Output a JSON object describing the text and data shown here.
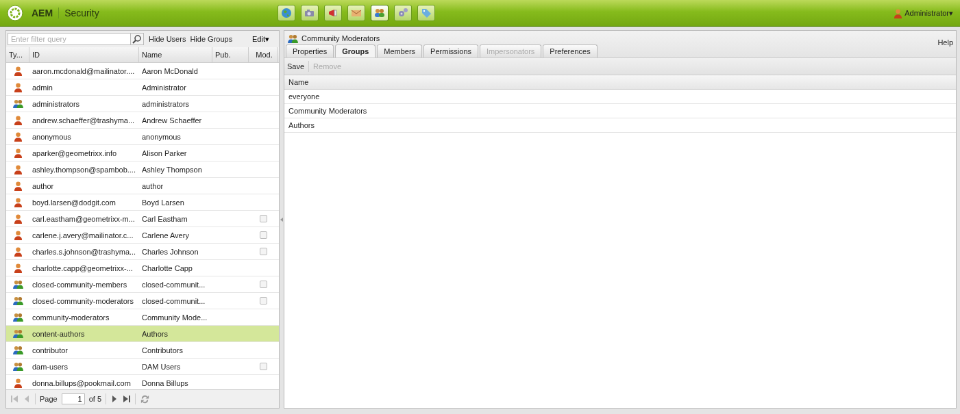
{
  "topbar": {
    "brand": "AEM",
    "section": "Security",
    "user": "Administrator",
    "caret": "▾"
  },
  "consoles": [
    {
      "kind": "globe",
      "selected": false
    },
    {
      "kind": "camera",
      "selected": false
    },
    {
      "kind": "megaphone",
      "selected": false
    },
    {
      "kind": "envelope",
      "selected": false
    },
    {
      "kind": "people",
      "selected": true
    },
    {
      "kind": "gears",
      "selected": false
    },
    {
      "kind": "tag",
      "selected": false
    }
  ],
  "left": {
    "filter": {
      "placeholder": "Enter filter query"
    },
    "links": [
      "Hide Users",
      "Hide Groups"
    ],
    "edit": "Edit",
    "caret": "▾",
    "columns": [
      "Ty...",
      "ID",
      "Name",
      "Pub.",
      "Mod."
    ],
    "rows": [
      {
        "kind": "user",
        "id": "aaron.mcdonald@mailinator....",
        "name": "Aaron McDonald",
        "selected": false
      },
      {
        "kind": "user",
        "id": "admin",
        "name": "Administrator",
        "selected": false
      },
      {
        "kind": "group",
        "id": "administrators",
        "name": "administrators",
        "selected": false
      },
      {
        "kind": "user",
        "id": "andrew.schaeffer@trashyma...",
        "name": "Andrew Schaeffer",
        "selected": false
      },
      {
        "kind": "user",
        "id": "anonymous",
        "name": "anonymous",
        "selected": false
      },
      {
        "kind": "user",
        "id": "aparker@geometrixx.info",
        "name": "Alison Parker",
        "selected": false
      },
      {
        "kind": "user",
        "id": "ashley.thompson@spambob....",
        "name": "Ashley Thompson",
        "selected": false
      },
      {
        "kind": "user",
        "id": "author",
        "name": "author",
        "selected": false
      },
      {
        "kind": "user",
        "id": "boyd.larsen@dodgit.com",
        "name": "Boyd Larsen",
        "selected": false
      },
      {
        "kind": "user",
        "id": "carl.eastham@geometrixx-m...",
        "name": "Carl Eastham",
        "selected": false,
        "moderated": false
      },
      {
        "kind": "user",
        "id": "carlene.j.avery@mailinator.c...",
        "name": "Carlene Avery",
        "selected": false,
        "moderated": false
      },
      {
        "kind": "user",
        "id": "charles.s.johnson@trashyma...",
        "name": "Charles Johnson",
        "selected": false,
        "moderated": false
      },
      {
        "kind": "user",
        "id": "charlotte.capp@geometrixx-...",
        "name": "Charlotte Capp",
        "selected": false
      },
      {
        "kind": "group",
        "id": "closed-community-members",
        "name": "closed-communit...",
        "selected": false,
        "moderated": false
      },
      {
        "kind": "group",
        "id": "closed-community-moderators",
        "name": "closed-communit...",
        "selected": false,
        "moderated": false
      },
      {
        "kind": "group",
        "id": "community-moderators",
        "name": "Community Mode...",
        "selected": false
      },
      {
        "kind": "group",
        "id": "content-authors",
        "name": "Authors",
        "selected": true
      },
      {
        "kind": "group",
        "id": "contributor",
        "name": "Contributors",
        "selected": false
      },
      {
        "kind": "group",
        "id": "dam-users",
        "name": "DAM Users",
        "selected": false,
        "moderated": false
      },
      {
        "kind": "user",
        "id": "donna.billups@pookmail.com",
        "name": "Donna Billups",
        "selected": false
      }
    ],
    "pager": {
      "label": "Page",
      "page": "1",
      "of": "of 5"
    }
  },
  "right": {
    "title": "Community Moderators",
    "help": "Help",
    "tabs": [
      {
        "label": "Properties",
        "selected": false,
        "disabled": false
      },
      {
        "label": "Groups",
        "selected": true,
        "disabled": false
      },
      {
        "label": "Members",
        "selected": false,
        "disabled": false
      },
      {
        "label": "Permissions",
        "selected": false,
        "disabled": false
      },
      {
        "label": "Impersonators",
        "selected": false,
        "disabled": true
      },
      {
        "label": "Preferences",
        "selected": false,
        "disabled": false
      }
    ],
    "toolbar": [
      {
        "label": "Save",
        "disabled": false
      },
      {
        "label": "Remove",
        "disabled": true
      }
    ],
    "column": "Name",
    "groups": [
      "everyone",
      "Community Moderators",
      "Authors"
    ]
  }
}
